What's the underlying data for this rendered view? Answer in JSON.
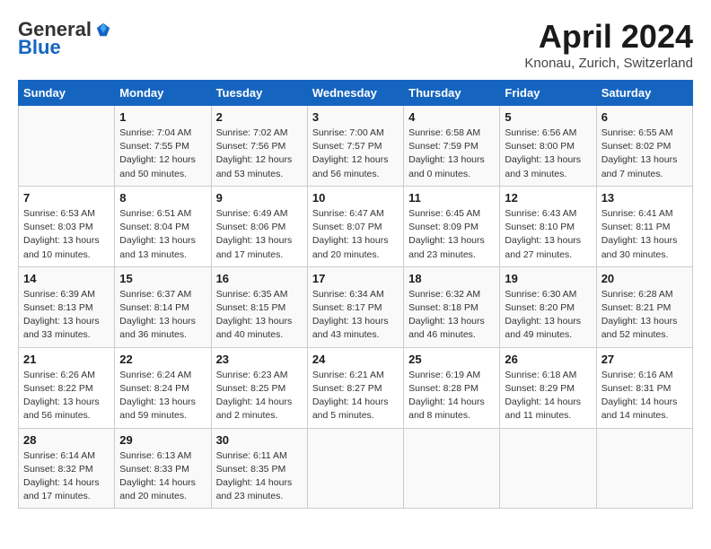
{
  "header": {
    "logo_general": "General",
    "logo_blue": "Blue",
    "month_title": "April 2024",
    "location": "Knonau, Zurich, Switzerland"
  },
  "calendar": {
    "days_of_week": [
      "Sunday",
      "Monday",
      "Tuesday",
      "Wednesday",
      "Thursday",
      "Friday",
      "Saturday"
    ],
    "weeks": [
      [
        {
          "day": "",
          "info": ""
        },
        {
          "day": "1",
          "info": "Sunrise: 7:04 AM\nSunset: 7:55 PM\nDaylight: 12 hours\nand 50 minutes."
        },
        {
          "day": "2",
          "info": "Sunrise: 7:02 AM\nSunset: 7:56 PM\nDaylight: 12 hours\nand 53 minutes."
        },
        {
          "day": "3",
          "info": "Sunrise: 7:00 AM\nSunset: 7:57 PM\nDaylight: 12 hours\nand 56 minutes."
        },
        {
          "day": "4",
          "info": "Sunrise: 6:58 AM\nSunset: 7:59 PM\nDaylight: 13 hours\nand 0 minutes."
        },
        {
          "day": "5",
          "info": "Sunrise: 6:56 AM\nSunset: 8:00 PM\nDaylight: 13 hours\nand 3 minutes."
        },
        {
          "day": "6",
          "info": "Sunrise: 6:55 AM\nSunset: 8:02 PM\nDaylight: 13 hours\nand 7 minutes."
        }
      ],
      [
        {
          "day": "7",
          "info": "Sunrise: 6:53 AM\nSunset: 8:03 PM\nDaylight: 13 hours\nand 10 minutes."
        },
        {
          "day": "8",
          "info": "Sunrise: 6:51 AM\nSunset: 8:04 PM\nDaylight: 13 hours\nand 13 minutes."
        },
        {
          "day": "9",
          "info": "Sunrise: 6:49 AM\nSunset: 8:06 PM\nDaylight: 13 hours\nand 17 minutes."
        },
        {
          "day": "10",
          "info": "Sunrise: 6:47 AM\nSunset: 8:07 PM\nDaylight: 13 hours\nand 20 minutes."
        },
        {
          "day": "11",
          "info": "Sunrise: 6:45 AM\nSunset: 8:09 PM\nDaylight: 13 hours\nand 23 minutes."
        },
        {
          "day": "12",
          "info": "Sunrise: 6:43 AM\nSunset: 8:10 PM\nDaylight: 13 hours\nand 27 minutes."
        },
        {
          "day": "13",
          "info": "Sunrise: 6:41 AM\nSunset: 8:11 PM\nDaylight: 13 hours\nand 30 minutes."
        }
      ],
      [
        {
          "day": "14",
          "info": "Sunrise: 6:39 AM\nSunset: 8:13 PM\nDaylight: 13 hours\nand 33 minutes."
        },
        {
          "day": "15",
          "info": "Sunrise: 6:37 AM\nSunset: 8:14 PM\nDaylight: 13 hours\nand 36 minutes."
        },
        {
          "day": "16",
          "info": "Sunrise: 6:35 AM\nSunset: 8:15 PM\nDaylight: 13 hours\nand 40 minutes."
        },
        {
          "day": "17",
          "info": "Sunrise: 6:34 AM\nSunset: 8:17 PM\nDaylight: 13 hours\nand 43 minutes."
        },
        {
          "day": "18",
          "info": "Sunrise: 6:32 AM\nSunset: 8:18 PM\nDaylight: 13 hours\nand 46 minutes."
        },
        {
          "day": "19",
          "info": "Sunrise: 6:30 AM\nSunset: 8:20 PM\nDaylight: 13 hours\nand 49 minutes."
        },
        {
          "day": "20",
          "info": "Sunrise: 6:28 AM\nSunset: 8:21 PM\nDaylight: 13 hours\nand 52 minutes."
        }
      ],
      [
        {
          "day": "21",
          "info": "Sunrise: 6:26 AM\nSunset: 8:22 PM\nDaylight: 13 hours\nand 56 minutes."
        },
        {
          "day": "22",
          "info": "Sunrise: 6:24 AM\nSunset: 8:24 PM\nDaylight: 13 hours\nand 59 minutes."
        },
        {
          "day": "23",
          "info": "Sunrise: 6:23 AM\nSunset: 8:25 PM\nDaylight: 14 hours\nand 2 minutes."
        },
        {
          "day": "24",
          "info": "Sunrise: 6:21 AM\nSunset: 8:27 PM\nDaylight: 14 hours\nand 5 minutes."
        },
        {
          "day": "25",
          "info": "Sunrise: 6:19 AM\nSunset: 8:28 PM\nDaylight: 14 hours\nand 8 minutes."
        },
        {
          "day": "26",
          "info": "Sunrise: 6:18 AM\nSunset: 8:29 PM\nDaylight: 14 hours\nand 11 minutes."
        },
        {
          "day": "27",
          "info": "Sunrise: 6:16 AM\nSunset: 8:31 PM\nDaylight: 14 hours\nand 14 minutes."
        }
      ],
      [
        {
          "day": "28",
          "info": "Sunrise: 6:14 AM\nSunset: 8:32 PM\nDaylight: 14 hours\nand 17 minutes."
        },
        {
          "day": "29",
          "info": "Sunrise: 6:13 AM\nSunset: 8:33 PM\nDaylight: 14 hours\nand 20 minutes."
        },
        {
          "day": "30",
          "info": "Sunrise: 6:11 AM\nSunset: 8:35 PM\nDaylight: 14 hours\nand 23 minutes."
        },
        {
          "day": "",
          "info": ""
        },
        {
          "day": "",
          "info": ""
        },
        {
          "day": "",
          "info": ""
        },
        {
          "day": "",
          "info": ""
        }
      ]
    ]
  }
}
